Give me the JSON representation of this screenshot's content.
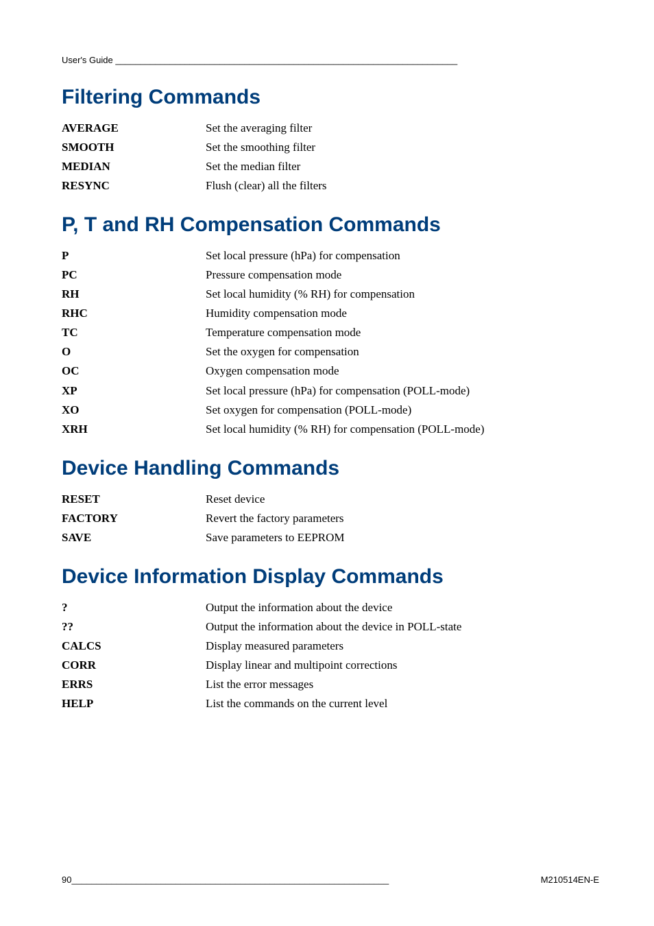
{
  "header": {
    "running_head": "User's Guide _____________________________________________________________________"
  },
  "sections": [
    {
      "title": "Filtering Commands",
      "rows": [
        {
          "cmd": "AVERAGE",
          "desc": "Set the averaging filter"
        },
        {
          "cmd": "SMOOTH",
          "desc": "Set the smoothing filter"
        },
        {
          "cmd": "MEDIAN",
          "desc": "Set the median filter"
        },
        {
          "cmd": "RESYNC",
          "desc": "Flush (clear) all the filters"
        }
      ]
    },
    {
      "title": "P, T and RH Compensation Commands",
      "rows": [
        {
          "cmd": "P",
          "desc": "Set local pressure (hPa) for compensation"
        },
        {
          "cmd": "PC",
          "desc": "Pressure compensation mode"
        },
        {
          "cmd": "RH",
          "desc": "Set local humidity (% RH) for compensation"
        },
        {
          "cmd": "RHC",
          "desc": "Humidity compensation mode"
        },
        {
          "cmd": "TC",
          "desc": "Temperature compensation mode"
        },
        {
          "cmd": "O",
          "desc": "Set the oxygen for compensation"
        },
        {
          "cmd": "OC",
          "desc": "Oxygen compensation mode"
        },
        {
          "cmd": "XP",
          "desc": "Set local pressure (hPa) for compensation (POLL-mode)"
        },
        {
          "cmd": "XO",
          "desc": "Set oxygen for compensation (POLL-mode)"
        },
        {
          "cmd": "XRH",
          "desc": "Set local humidity (% RH) for compensation (POLL-mode)"
        }
      ]
    },
    {
      "title": "Device Handling Commands",
      "rows": [
        {
          "cmd": "RESET",
          "desc": "Reset device"
        },
        {
          "cmd": "FACTORY",
          "desc": "Revert the factory parameters"
        },
        {
          "cmd": "SAVE",
          "desc": "Save parameters to EEPROM"
        }
      ]
    },
    {
      "title": "Device Information Display Commands",
      "rows": [
        {
          "cmd": "?",
          "desc": "Output the information about the device"
        },
        {
          "cmd": "??",
          "desc": "Output the information about the device in POLL-state"
        },
        {
          "cmd": "CALCS",
          "desc": "Display measured parameters"
        },
        {
          "cmd": "CORR",
          "desc": "Display linear and multipoint corrections"
        },
        {
          "cmd": "ERRS",
          "desc": "List the error messages"
        },
        {
          "cmd": "HELP",
          "desc": "List the commands on the current level"
        }
      ]
    }
  ],
  "footer": {
    "page_no": "90 ",
    "fill": "________________________________________________________________",
    "doc_id": "M210514EN-E"
  }
}
